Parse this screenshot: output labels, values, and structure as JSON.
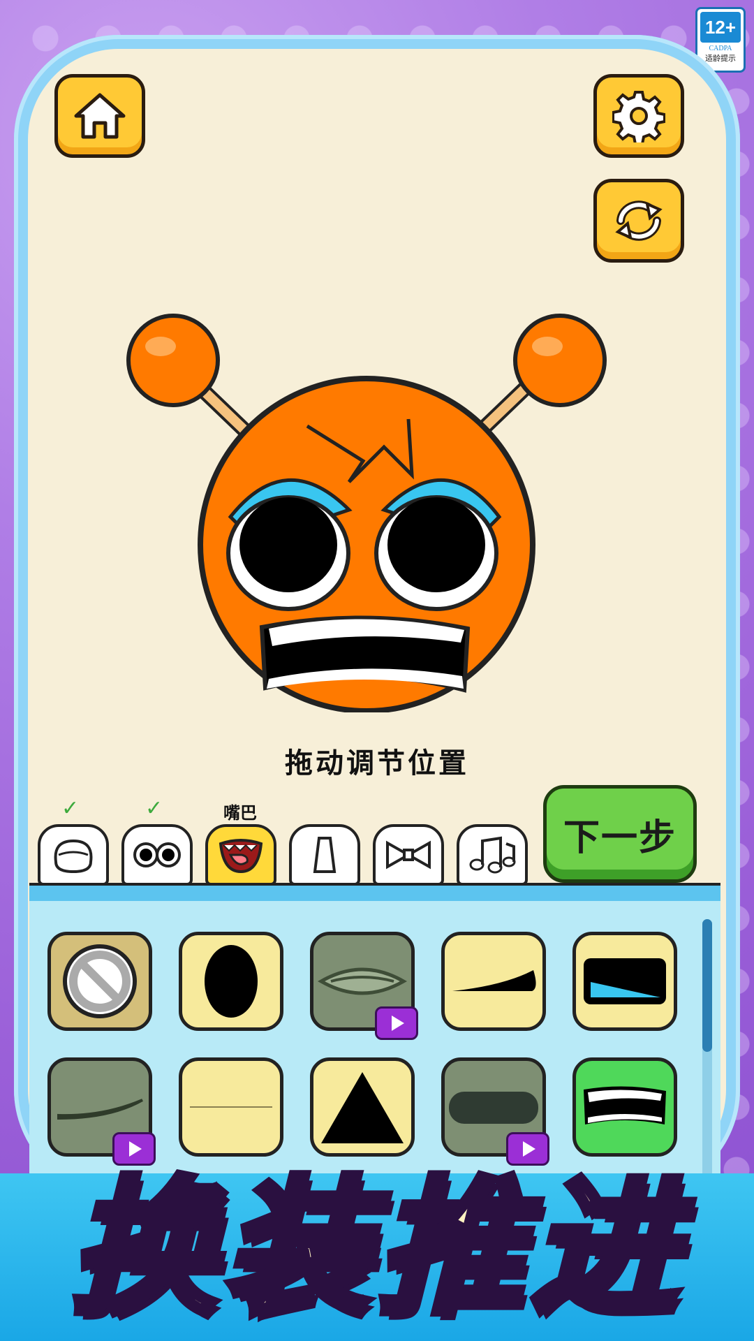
{
  "age_badge": {
    "rating": "12+",
    "org": "CADPA",
    "tip": "适龄提示"
  },
  "toolbar": {
    "home_icon": "home-icon",
    "settings_icon": "gear-icon",
    "reset_icon": "refresh-icon"
  },
  "hint": "拖动调节位置",
  "tabs": [
    {
      "icon": "face-shape-icon",
      "done": true,
      "check": "✓"
    },
    {
      "icon": "eyes-icon",
      "done": true,
      "check": "✓"
    },
    {
      "icon": "mouth-icon",
      "active": true,
      "label": "嘴巴"
    },
    {
      "icon": "nose-icon"
    },
    {
      "icon": "bow-icon"
    },
    {
      "icon": "music-icon"
    }
  ],
  "next_label": "下一步",
  "items": [
    {
      "icon": "none-icon",
      "bg": "#d4bf7a",
      "ad": false
    },
    {
      "icon": "oval-mouth-icon",
      "bg": "#f7ea9c",
      "ad": false
    },
    {
      "icon": "lips-icon",
      "bg": "#7e8f73",
      "ad": true
    },
    {
      "icon": "smirk-icon",
      "bg": "#f7ea9c",
      "ad": false
    },
    {
      "icon": "open-mouth-icon",
      "bg": "#f7ea9c",
      "ad": false
    },
    {
      "icon": "curve-mouth-icon",
      "bg": "#7e8f73",
      "ad": true
    },
    {
      "icon": "line-mouth-icon",
      "bg": "#f7ea9c",
      "ad": false
    },
    {
      "icon": "triangle-mouth-icon",
      "bg": "#f7ea9c",
      "ad": false
    },
    {
      "icon": "rect-mouth-icon",
      "bg": "#7e8f73",
      "ad": true
    },
    {
      "icon": "teeth-mouth-icon",
      "bg": "#4fd85a",
      "ad": false,
      "selected": true
    }
  ],
  "banner": "换装推进",
  "colors": {
    "accent_yellow": "#ffc935",
    "next_green": "#6fd04a",
    "character_orange": "#ff7a00"
  }
}
